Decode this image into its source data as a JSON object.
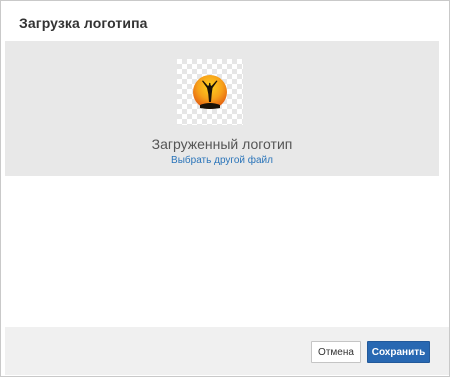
{
  "dialog": {
    "title": "Загрузка логотипа"
  },
  "upload": {
    "logo_icon": "sunset-silhouette-logo",
    "caption": "Загруженный логотип",
    "change_link": "Выбрать другой файл"
  },
  "footer": {
    "cancel_label": "Отмена",
    "save_label": "Сохранить"
  },
  "colors": {
    "link": "#2a74b9",
    "primary_button": "#2868b2",
    "upload_area_bg": "#e8e8e8"
  }
}
